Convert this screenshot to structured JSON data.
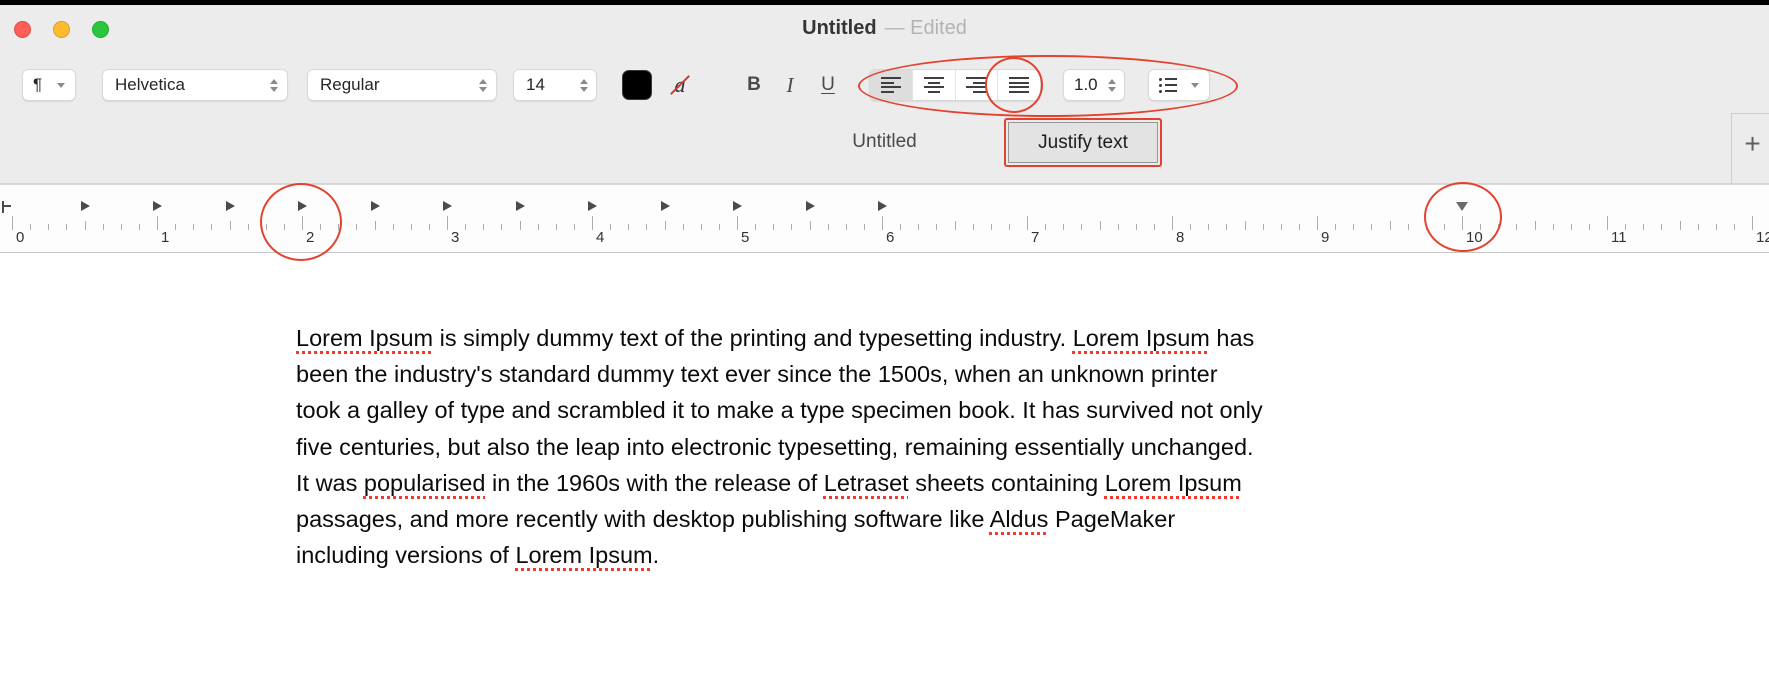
{
  "window": {
    "title": "Untitled",
    "edited": "— Edited"
  },
  "toolbar": {
    "paragraph_style": "¶",
    "font_family": "Helvetica",
    "font_style": "Regular",
    "font_size": "14",
    "text_color_label": "a",
    "bold": "B",
    "italic": "I",
    "underline": "U",
    "line_spacing": "1.0"
  },
  "tab_bar": {
    "tab": "Untitled",
    "tooltip": "Justify text",
    "new_tab": "+"
  },
  "ruler": {
    "numbers": [
      "0",
      "1",
      "2",
      "3",
      "4",
      "5",
      "6",
      "7",
      "8",
      "9",
      "10",
      "11",
      "12"
    ],
    "tab_stops_inches": [
      0.5,
      1,
      1.5,
      2,
      2.5,
      3,
      3.5,
      4,
      4.5,
      5,
      5.5,
      6
    ],
    "margin_marker_inch": 10
  },
  "document": {
    "lines": [
      {
        "segments": [
          {
            "text": "Lorem Ipsum",
            "misspelled": true
          },
          {
            "text": " is simply dummy text of the printing and typesetting industry. "
          },
          {
            "text": "Lorem Ipsum",
            "misspelled": true
          },
          {
            "text": " has"
          }
        ]
      },
      {
        "segments": [
          {
            "text": "been the industry's standard dummy text ever since the 1500s, when an unknown printer"
          }
        ]
      },
      {
        "segments": [
          {
            "text": "took a galley of type and scrambled it to make a type specimen book. It has survived not only"
          }
        ]
      },
      {
        "segments": [
          {
            "text": "five centuries, but also the leap into electronic typesetting, remaining essentially unchanged."
          }
        ]
      },
      {
        "segments": [
          {
            "text": "It was "
          },
          {
            "text": "popularised",
            "misspelled": true
          },
          {
            "text": " in the 1960s with the release of "
          },
          {
            "text": "Letraset",
            "misspelled": true
          },
          {
            "text": " sheets containing "
          },
          {
            "text": "Lorem Ipsum",
            "misspelled": true
          }
        ]
      },
      {
        "segments": [
          {
            "text": "passages, and more recently with desktop publishing software like "
          },
          {
            "text": "Aldus",
            "misspelled": true
          },
          {
            "text": " PageMaker"
          }
        ]
      },
      {
        "segments": [
          {
            "text": "including versions of "
          },
          {
            "text": "Lorem Ipsum",
            "misspelled": true
          },
          {
            "text": "."
          }
        ]
      }
    ]
  },
  "colors": {
    "annotation": "#e2432f",
    "close_button": "#ff5f57",
    "minimize_button": "#febc2e",
    "zoom_button": "#2ac73e",
    "font_color": "#000000",
    "misspell_underline": "#f23b2e"
  }
}
